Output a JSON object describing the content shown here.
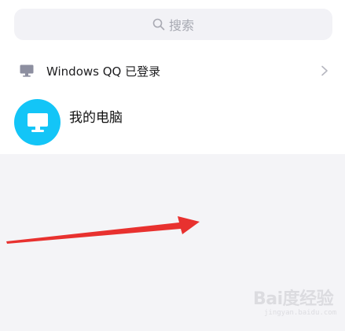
{
  "search": {
    "label": "搜索",
    "icon": "search-icon"
  },
  "device_login": {
    "label": "Windows QQ 已登录",
    "icon": "monitor-icon"
  },
  "contact": {
    "name": "我的电脑",
    "avatar_icon": "monitor-icon",
    "avatar_color": "#13c5f7"
  },
  "annotation": {
    "arrow_color": "#e8312f"
  },
  "watermark": {
    "main": "Bai度经验",
    "sub": "jingyan.baidu.com"
  },
  "colors": {
    "background": "#f4f4f7",
    "panel": "#ffffff",
    "search_bg": "#f2f2f6"
  }
}
